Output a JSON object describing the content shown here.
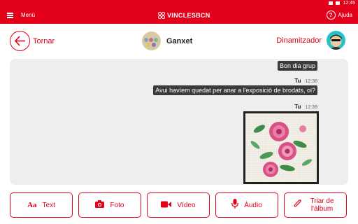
{
  "status_bar": {
    "time": "12:45"
  },
  "app_bar": {
    "menu_label": "Menú",
    "brand": "VINCLESBCN",
    "help_label": "Ajuda"
  },
  "header": {
    "back_label": "Tornar",
    "group_name": "Ganxet",
    "dinamitzador_label": "Dinamitzador"
  },
  "chat": {
    "messages": [
      {
        "sender": "",
        "time": "",
        "text": "Bon dia grup"
      },
      {
        "sender": "Tu",
        "time": "12:38",
        "text": "Avui havíem quedat per anar a l'exposició de brodats, oi?"
      },
      {
        "sender": "Tu",
        "time": "12:39",
        "text": ""
      }
    ]
  },
  "actions": [
    {
      "label": "Text",
      "icon": "text-icon"
    },
    {
      "label": "Foto",
      "icon": "camera-icon"
    },
    {
      "label": "Vídeo",
      "icon": "video-icon"
    },
    {
      "label": "Àudio",
      "icon": "microphone-icon"
    },
    {
      "label": "Triar de l'àlbum",
      "icon": "paperclip-icon"
    }
  ],
  "colors": {
    "accent": "#e2001a",
    "bubble": "#3a3a3a",
    "chat_bg": "#eeeeee"
  }
}
